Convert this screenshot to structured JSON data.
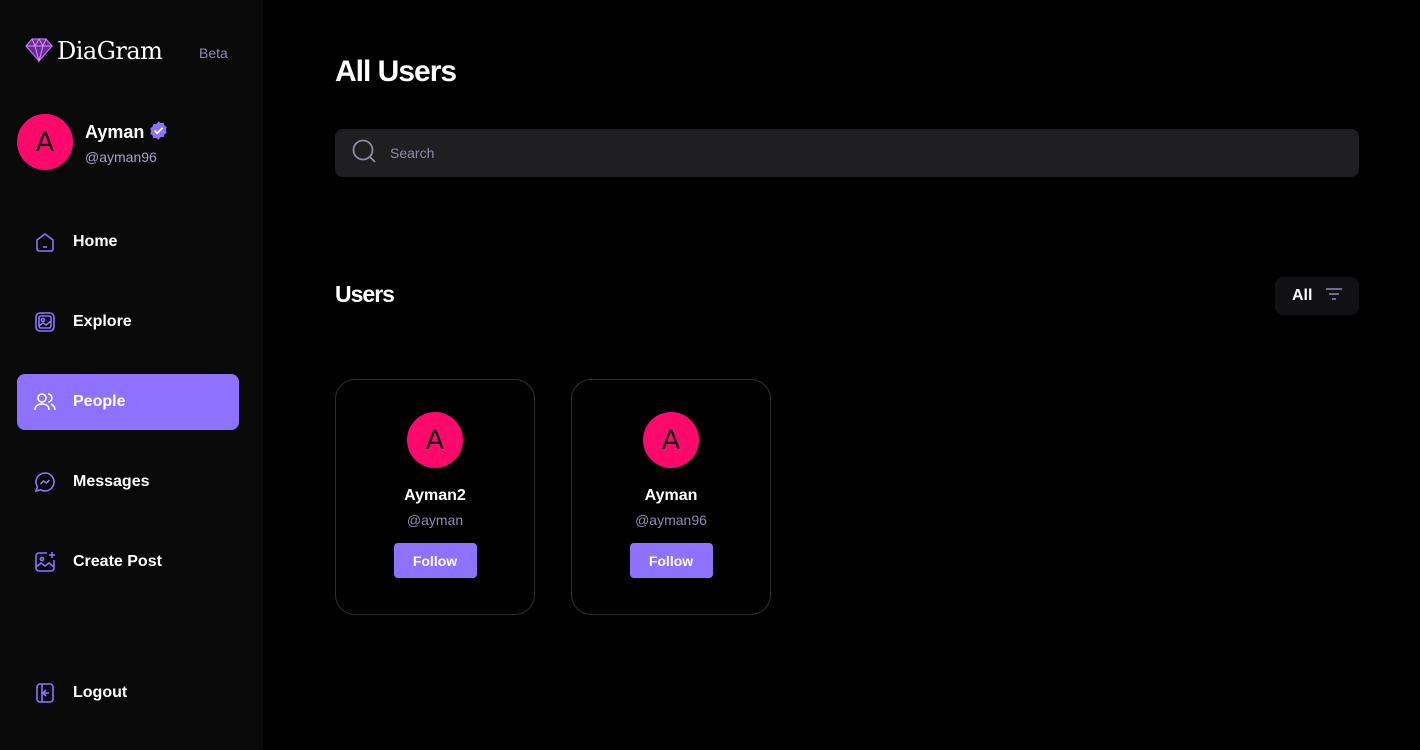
{
  "brand": {
    "name": "DiaGram",
    "badge": "Beta",
    "logo_icon": "diamond-icon",
    "accent": "#8e72ff"
  },
  "profile": {
    "initial": "A",
    "name": "Ayman",
    "handle": "@ayman96",
    "verified_icon": "verified-badge-icon",
    "avatar_color": "#ff0a6c"
  },
  "nav": {
    "items": [
      {
        "label": "Home",
        "icon": "home-icon",
        "active": false
      },
      {
        "label": "Explore",
        "icon": "gallery-icon",
        "active": false
      },
      {
        "label": "People",
        "icon": "people-icon",
        "active": true
      },
      {
        "label": "Messages",
        "icon": "messenger-icon",
        "active": false
      },
      {
        "label": "Create Post",
        "icon": "add-image-icon",
        "active": false
      }
    ],
    "logout": {
      "label": "Logout",
      "icon": "logout-icon"
    }
  },
  "main": {
    "title": "All Users",
    "search": {
      "placeholder": "Search",
      "value": ""
    },
    "section_title": "Users",
    "filter": {
      "label": "All",
      "icon": "filter-icon"
    },
    "users": [
      {
        "initial": "A",
        "name": "Ayman2",
        "handle": "@ayman",
        "button": "Follow"
      },
      {
        "initial": "A",
        "name": "Ayman",
        "handle": "@ayman96",
        "button": "Follow"
      }
    ]
  }
}
